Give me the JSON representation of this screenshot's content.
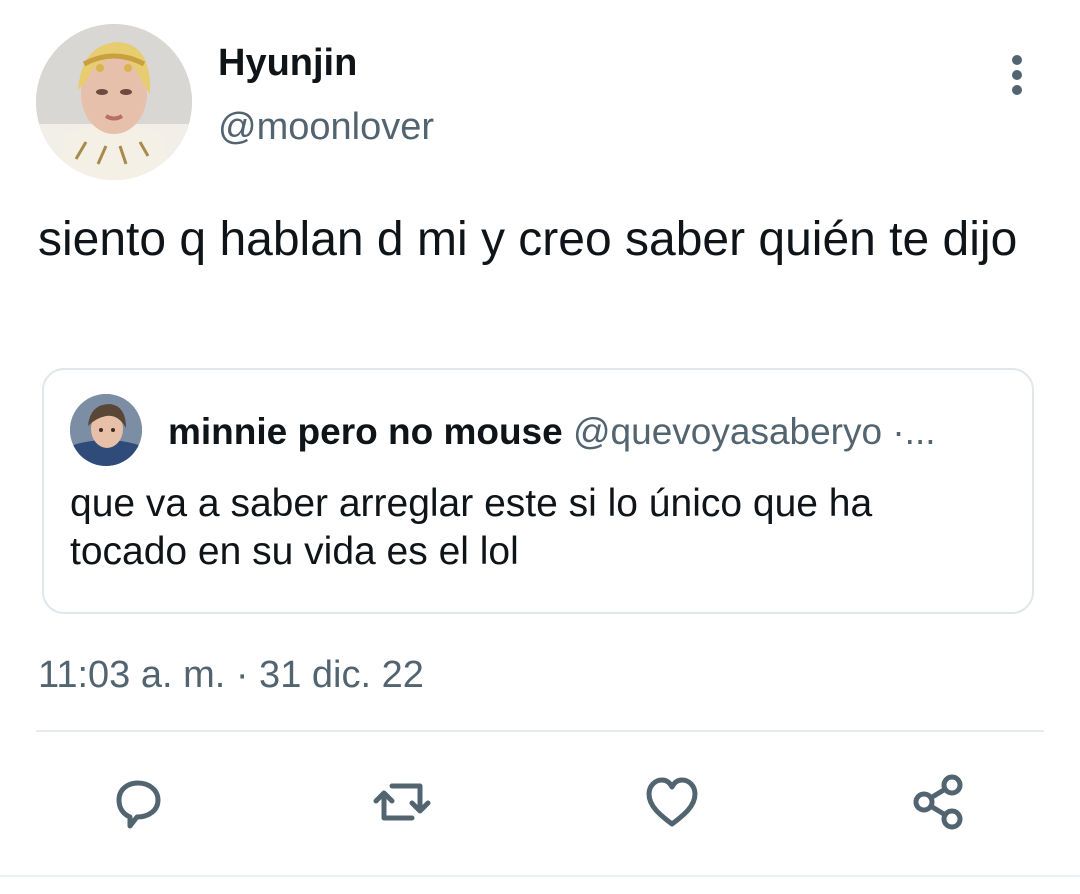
{
  "author": {
    "name": "Hyunjin",
    "handle": "@moonlover"
  },
  "tweet": {
    "text": "siento q hablan d mi y creo saber quién te dijo",
    "timestamp": "11:03 a. m. · 31 dic. 22"
  },
  "quoted_tweet": {
    "name": "minnie pero no mouse",
    "handle_meta": "@quevoyasaberyo ·...",
    "text": "que va a saber arreglar este si lo único que ha tocado en su vida es el lol"
  },
  "icons": {
    "more": "more-vertical-icon",
    "reply": "reply-icon",
    "retweet": "retweet-icon",
    "like": "heart-icon",
    "share": "share-icon"
  },
  "colors": {
    "text_primary": "#0f1419",
    "text_secondary": "#536471",
    "icon": "#536471",
    "border": "#e1e6ea"
  }
}
